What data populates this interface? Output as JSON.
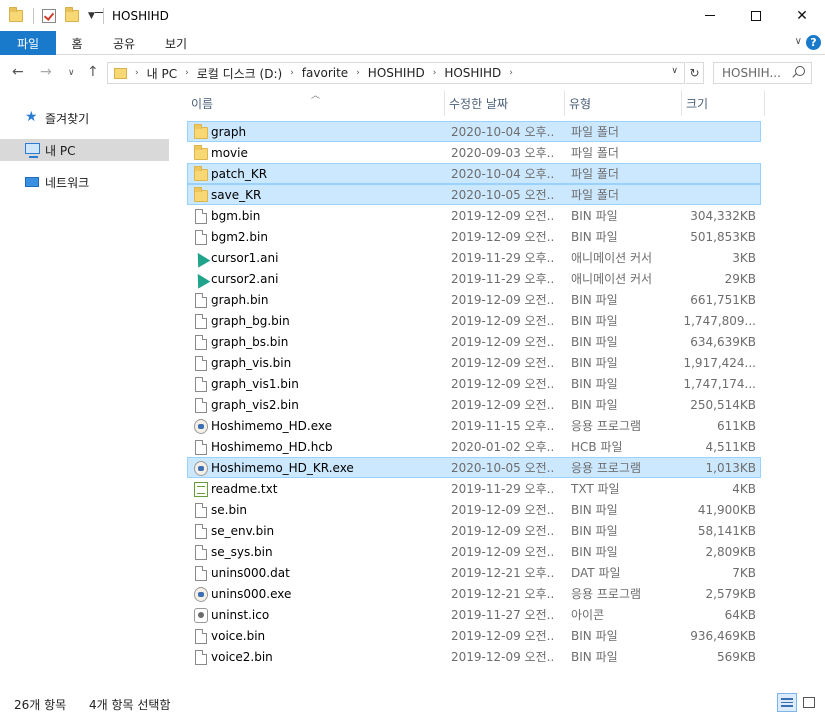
{
  "window": {
    "title": "HOSHIHD",
    "buttons": {
      "minimize": "minimize",
      "maximize": "maximize",
      "close": "✕"
    }
  },
  "ribbon": {
    "tabs": [
      "파일",
      "홈",
      "공유",
      "보기"
    ],
    "collapse_icon": "chevron-down-icon",
    "help_label": "?"
  },
  "address": {
    "crumbs": [
      "내 PC",
      "로컬 디스크 (D:)",
      "favorite",
      "HOSHIHD",
      "HOSHIHD"
    ],
    "search_placeholder": "HOSHIH..."
  },
  "nav": {
    "items": [
      {
        "label": "즐겨찾기",
        "icon": "star-icon"
      },
      {
        "label": "내 PC",
        "icon": "computer-icon",
        "selected": true
      },
      {
        "label": "네트워크",
        "icon": "network-icon"
      }
    ]
  },
  "columns": {
    "name": "이름",
    "date": "수정한 날짜",
    "type": "유형",
    "size": "크기"
  },
  "files": [
    {
      "name": "graph",
      "date": "2020-10-04 오후...",
      "type": "파일 폴더",
      "size": "",
      "icon": "folder-icon",
      "selected": true
    },
    {
      "name": "movie",
      "date": "2020-09-03 오후...",
      "type": "파일 폴더",
      "size": "",
      "icon": "folder-icon",
      "selected": false
    },
    {
      "name": "patch_KR",
      "date": "2020-10-04 오후...",
      "type": "파일 폴더",
      "size": "",
      "icon": "folder-icon",
      "selected": true
    },
    {
      "name": "save_KR",
      "date": "2020-10-05 오전...",
      "type": "파일 폴더",
      "size": "",
      "icon": "folder-icon",
      "selected": true
    },
    {
      "name": "bgm.bin",
      "date": "2019-12-09 오전...",
      "type": "BIN 파일",
      "size": "304,332KB",
      "icon": "file-icon",
      "selected": false
    },
    {
      "name": "bgm2.bin",
      "date": "2019-12-09 오전...",
      "type": "BIN 파일",
      "size": "501,853KB",
      "icon": "file-icon",
      "selected": false
    },
    {
      "name": "cursor1.ani",
      "date": "2019-11-29 오후...",
      "type": "애니메이션 커서",
      "size": "3KB",
      "icon": "cursor-icon",
      "selected": false
    },
    {
      "name": "cursor2.ani",
      "date": "2019-11-29 오후...",
      "type": "애니메이션 커서",
      "size": "29KB",
      "icon": "cursor-icon",
      "selected": false
    },
    {
      "name": "graph.bin",
      "date": "2019-12-09 오전...",
      "type": "BIN 파일",
      "size": "661,751KB",
      "icon": "file-icon",
      "selected": false
    },
    {
      "name": "graph_bg.bin",
      "date": "2019-12-09 오전...",
      "type": "BIN 파일",
      "size": "1,747,809...",
      "icon": "file-icon",
      "selected": false
    },
    {
      "name": "graph_bs.bin",
      "date": "2019-12-09 오전...",
      "type": "BIN 파일",
      "size": "634,639KB",
      "icon": "file-icon",
      "selected": false
    },
    {
      "name": "graph_vis.bin",
      "date": "2019-12-09 오전...",
      "type": "BIN 파일",
      "size": "1,917,424...",
      "icon": "file-icon",
      "selected": false
    },
    {
      "name": "graph_vis1.bin",
      "date": "2019-12-09 오전...",
      "type": "BIN 파일",
      "size": "1,747,174...",
      "icon": "file-icon",
      "selected": false
    },
    {
      "name": "graph_vis2.bin",
      "date": "2019-12-09 오전...",
      "type": "BIN 파일",
      "size": "250,514KB",
      "icon": "file-icon",
      "selected": false
    },
    {
      "name": "Hoshimemo_HD.exe",
      "date": "2019-11-15 오후...",
      "type": "응용 프로그램",
      "size": "611KB",
      "icon": "app-icon",
      "selected": false
    },
    {
      "name": "Hoshimemo_HD.hcb",
      "date": "2020-01-02 오후...",
      "type": "HCB 파일",
      "size": "4,511KB",
      "icon": "file-icon",
      "selected": false
    },
    {
      "name": "Hoshimemo_HD_KR.exe",
      "date": "2020-10-05 오전...",
      "type": "응용 프로그램",
      "size": "1,013KB",
      "icon": "app-icon",
      "selected": true
    },
    {
      "name": "readme.txt",
      "date": "2019-11-29 오후...",
      "type": "TXT 파일",
      "size": "4KB",
      "icon": "text-file-icon",
      "selected": false
    },
    {
      "name": "se.bin",
      "date": "2019-12-09 오전...",
      "type": "BIN 파일",
      "size": "41,900KB",
      "icon": "file-icon",
      "selected": false
    },
    {
      "name": "se_env.bin",
      "date": "2019-12-09 오전...",
      "type": "BIN 파일",
      "size": "58,141KB",
      "icon": "file-icon",
      "selected": false
    },
    {
      "name": "se_sys.bin",
      "date": "2019-12-09 오전...",
      "type": "BIN 파일",
      "size": "2,809KB",
      "icon": "file-icon",
      "selected": false
    },
    {
      "name": "unins000.dat",
      "date": "2019-12-21 오후...",
      "type": "DAT 파일",
      "size": "7KB",
      "icon": "file-icon",
      "selected": false
    },
    {
      "name": "unins000.exe",
      "date": "2019-12-21 오후...",
      "type": "응용 프로그램",
      "size": "2,579KB",
      "icon": "app-icon",
      "selected": false
    },
    {
      "name": "uninst.ico",
      "date": "2019-11-27 오전...",
      "type": "아이콘",
      "size": "64KB",
      "icon": "icon-file-icon",
      "selected": false
    },
    {
      "name": "voice.bin",
      "date": "2019-12-09 오전...",
      "type": "BIN 파일",
      "size": "936,469KB",
      "icon": "file-icon",
      "selected": false
    },
    {
      "name": "voice2.bin",
      "date": "2019-12-09 오전...",
      "type": "BIN 파일",
      "size": "569KB",
      "icon": "file-icon",
      "selected": false
    }
  ],
  "status": {
    "count": "26개 항목",
    "selected": "4개 항목 선택함"
  },
  "colors": {
    "accent": "#1979ca",
    "selection_bg": "#cce8ff",
    "selection_border": "#99d1ff",
    "nav_selected": "#d9d9d9",
    "header_text": "#4c607a"
  }
}
